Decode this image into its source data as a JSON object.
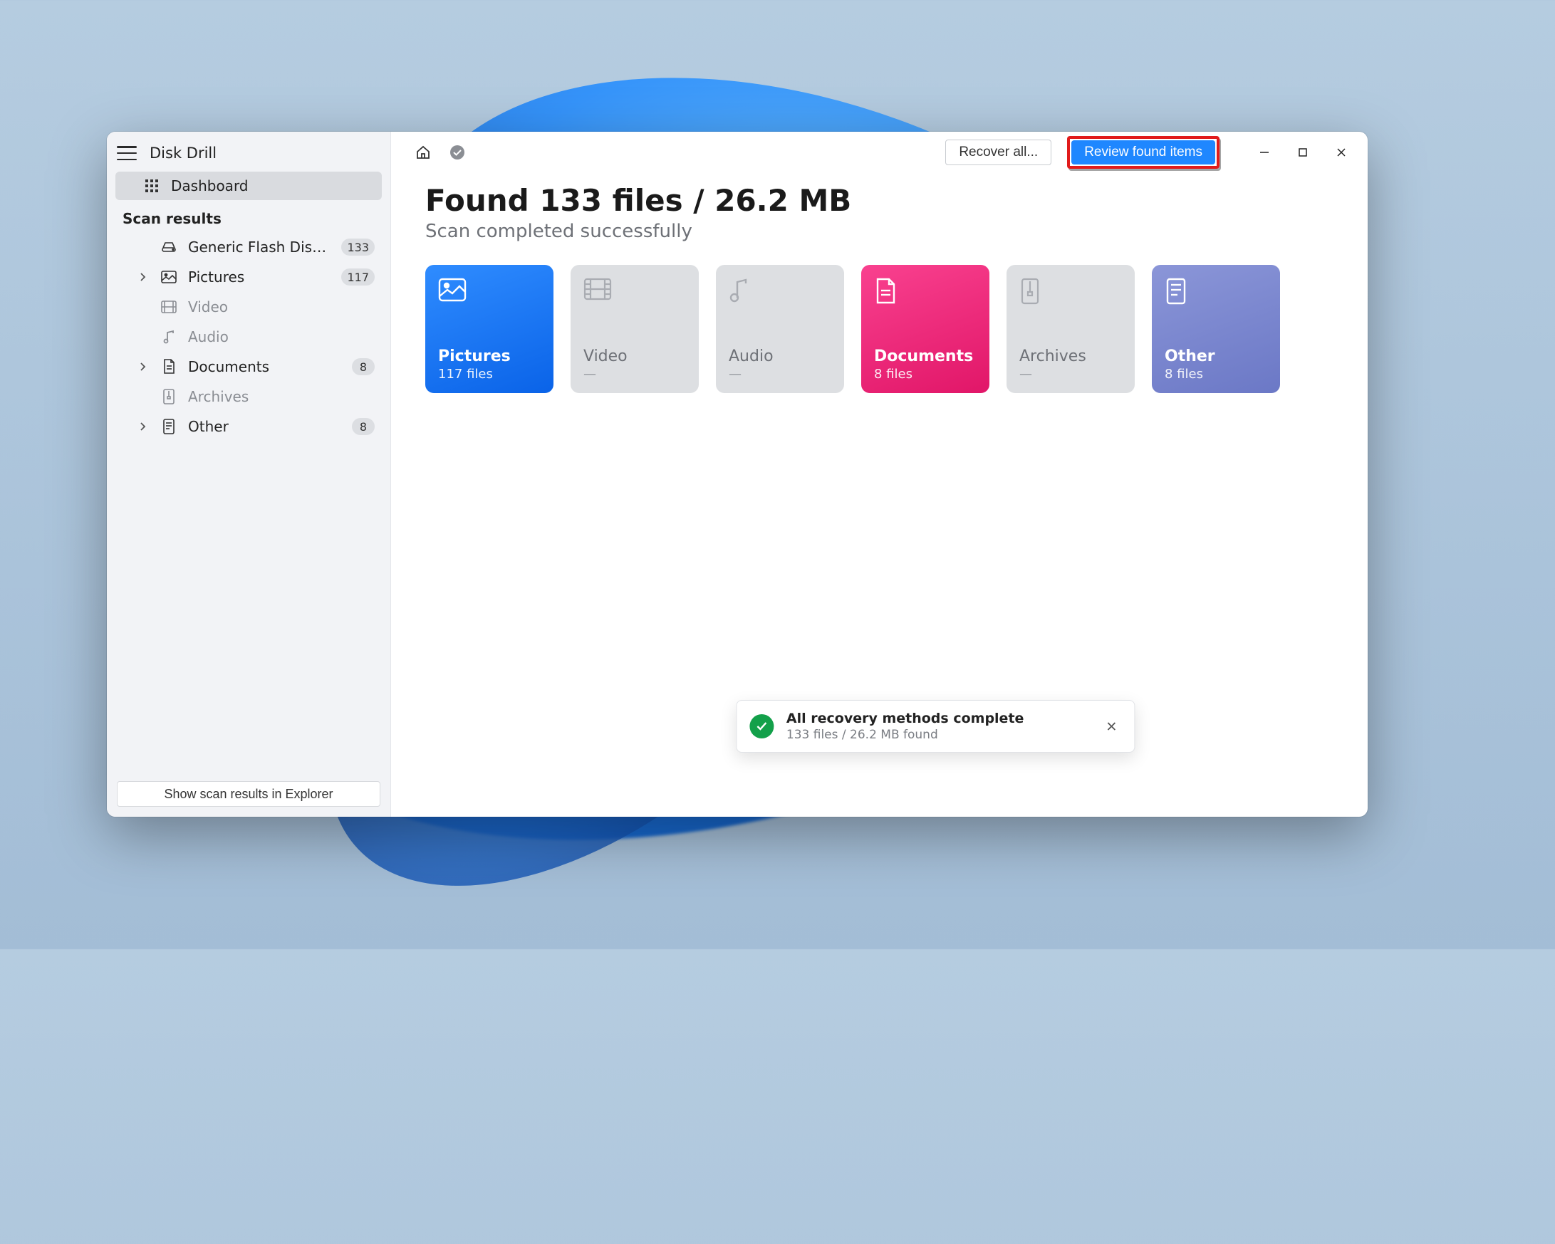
{
  "app": {
    "title": "Disk Drill"
  },
  "sidebar": {
    "dashboard_label": "Dashboard",
    "section_label": "Scan results",
    "items": [
      {
        "icon": "drive",
        "label": "Generic Flash Disk USB...",
        "count": "133",
        "expandable": false,
        "dim": false
      },
      {
        "icon": "picture",
        "label": "Pictures",
        "count": "117",
        "expandable": true,
        "dim": false
      },
      {
        "icon": "video",
        "label": "Video",
        "expandable": false,
        "dim": true
      },
      {
        "icon": "audio",
        "label": "Audio",
        "expandable": false,
        "dim": true
      },
      {
        "icon": "document",
        "label": "Documents",
        "count": "8",
        "expandable": true,
        "dim": false
      },
      {
        "icon": "archive",
        "label": "Archives",
        "expandable": false,
        "dim": true
      },
      {
        "icon": "other",
        "label": "Other",
        "count": "8",
        "expandable": true,
        "dim": false
      }
    ],
    "footer_button": "Show scan results in Explorer"
  },
  "topbar": {
    "recover_label": "Recover all...",
    "review_label": "Review found items"
  },
  "summary": {
    "headline": "Found 133 files / 26.2 MB",
    "subhead": "Scan completed successfully"
  },
  "cards": {
    "pictures": {
      "title": "Pictures",
      "sub": "117 files"
    },
    "video": {
      "title": "Video"
    },
    "audio": {
      "title": "Audio"
    },
    "documents": {
      "title": "Documents",
      "sub": "8 files"
    },
    "archives": {
      "title": "Archives"
    },
    "other": {
      "title": "Other",
      "sub": "8 files"
    }
  },
  "toast": {
    "title": "All recovery methods complete",
    "sub": "133 files / 26.2 MB found"
  }
}
